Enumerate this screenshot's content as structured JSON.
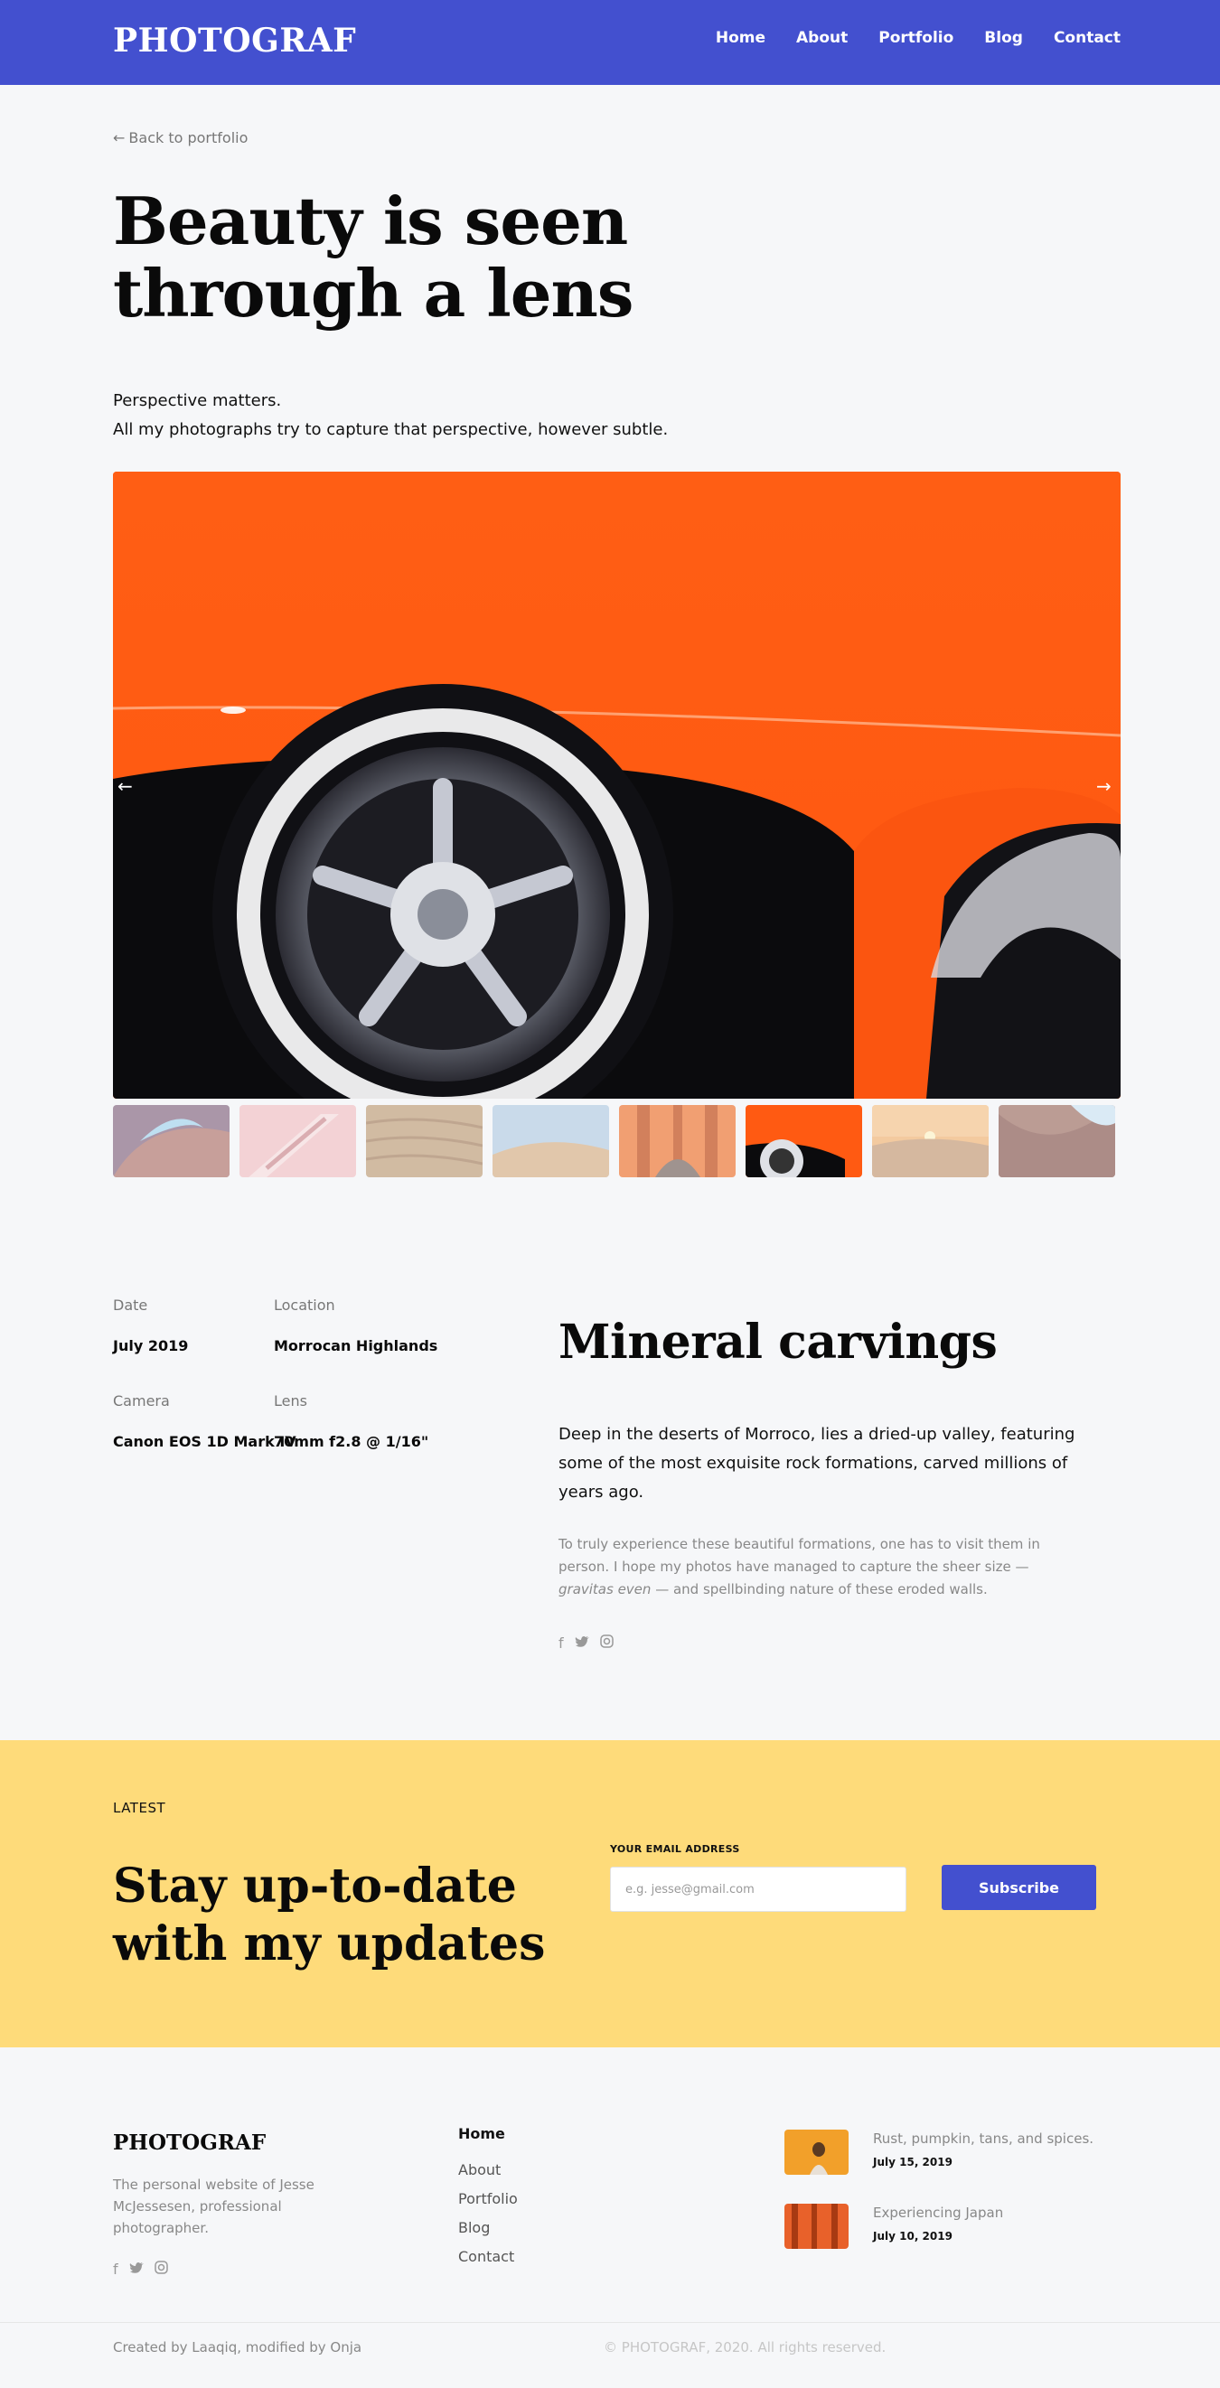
{
  "brand": {
    "name": "PHOTOGRAF",
    "accent": "#4350cf",
    "news_bg": "#fedb7a"
  },
  "nav": {
    "items": [
      "Home",
      "About",
      "Portfolio",
      "Blog",
      "Contact"
    ]
  },
  "page": {
    "back_label": "Back to portfolio",
    "title_line1": "Beauty is seen",
    "title_line2": "through a lens",
    "intro_line1": "Perspective matters.",
    "intro_line2": "All my photographs try to capture that perspective, however subtle."
  },
  "gallery": {
    "prev_arrow": "←",
    "next_arrow": "→",
    "active_index": 5,
    "thumb_count": 8
  },
  "details": {
    "date_label": "Date",
    "date_value": "July 2019",
    "location_label": "Location",
    "location_value": "Morrocan Highlands",
    "camera_label": "Camera",
    "camera_value": "Canon EOS 1D Mark IV",
    "lens_label": "Lens",
    "lens_value": "70mm f2.8 @ 1/16\"",
    "heading": "Mineral carvings",
    "lead": "Deep in the deserts of Morroco, lies a dried-up valley, featuring some of the most exquisite rock formations, carved millions of years ago.",
    "body_part1": "To truly experience these beautiful formations, one has to visit them in person. I hope my photos have managed to capture the sheer size — ",
    "body_em": "gravitas even",
    "body_part2": " — and spellbinding nature of these eroded walls.",
    "social_icons": [
      "facebook-icon",
      "twitter-icon",
      "instagram-icon"
    ]
  },
  "newsletter": {
    "kicker": "LATEST",
    "title_line1": "Stay up-to-date",
    "title_line2": "with my updates",
    "email_label": "YOUR EMAIL ADDRESS",
    "email_placeholder": "e.g. jesse@gmail.com",
    "button_label": "Subscribe"
  },
  "footer": {
    "logo": "PHOTOGRAF",
    "description": "The personal website of Jesse McJessesen, professional photographer.",
    "links_heading": "Home",
    "links": [
      "About",
      "Portfolio",
      "Blog",
      "Contact"
    ],
    "posts": [
      {
        "title": "Rust, pumpkin, tans, and spices.",
        "date": "July 15, 2019"
      },
      {
        "title": "Experiencing Japan",
        "date": "July 10, 2019"
      }
    ],
    "credit": "Created by Laaqiq, modified by Onja",
    "copyright": "© PHOTOGRAF, 2020. All rights reserved."
  }
}
